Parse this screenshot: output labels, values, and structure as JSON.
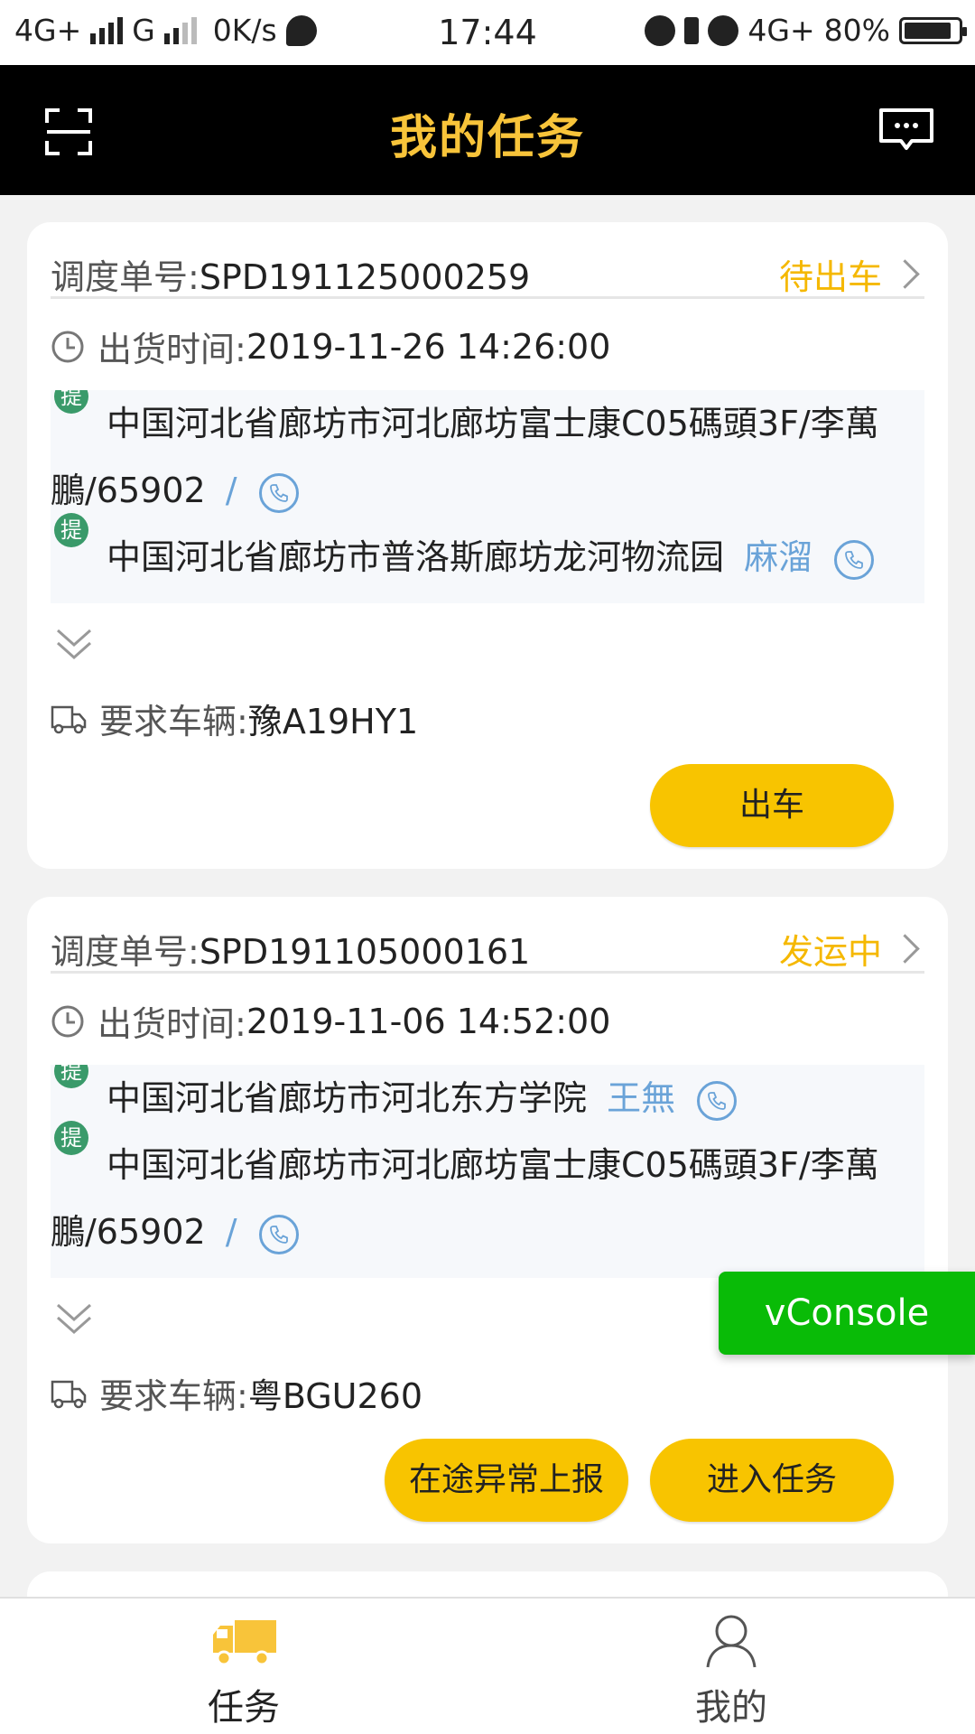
{
  "status_bar": {
    "network1": "4G+",
    "network2": "G",
    "speed": "0K/s",
    "time": "17:44",
    "network3": "4G+",
    "battery": "80%"
  },
  "header": {
    "title": "我的任务"
  },
  "tasks": [
    {
      "order_label": "调度单号:",
      "order_no": "SPD191125000259",
      "status": "待出车",
      "ship_time_label": "出货时间:",
      "ship_time": "2019-11-26 14:26:00",
      "addresses": [
        {
          "tag": "提",
          "line1": "中国河北省廊坊市河北廊坊富士康C05碼頭3F/李萬",
          "line2": "鵬/65902",
          "contact": "/"
        },
        {
          "tag": "提",
          "line1": "中国河北省廊坊市普洛斯廊坊龙河物流园",
          "contact": "麻溜"
        }
      ],
      "vehicle_label": "要求车辆:",
      "vehicle": "豫A19HY1",
      "buttons": [
        "出车"
      ]
    },
    {
      "order_label": "调度单号:",
      "order_no": "SPD191105000161",
      "status": "发运中",
      "ship_time_label": "出货时间:",
      "ship_time": "2019-11-06 14:52:00",
      "addresses": [
        {
          "tag": "提",
          "line1": "中国河北省廊坊市河北东方学院",
          "contact": "王無"
        },
        {
          "tag": "提",
          "line1": "中国河北省廊坊市河北廊坊富士康C05碼頭3F/李萬",
          "line2": "鵬/65902",
          "contact": "/"
        }
      ],
      "vehicle_label": "要求车辆:",
      "vehicle": "粤BGU260",
      "buttons": [
        "在途异常上报",
        "进入任务"
      ]
    }
  ],
  "vconsole": "vConsole",
  "bottom_nav": {
    "tasks": "任务",
    "me": "我的"
  },
  "colors": {
    "accent": "#f8c400",
    "header_bg": "#000000",
    "title": "#f8c43a",
    "tag_green": "#3a9a6a",
    "contact_blue": "#6aa3d8",
    "vconsole_green": "#09bb07"
  }
}
